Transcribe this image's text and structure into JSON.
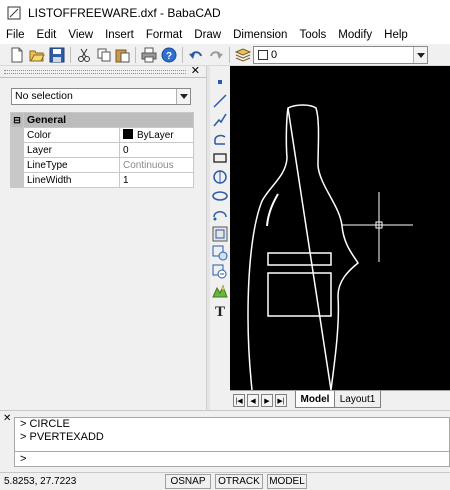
{
  "window": {
    "title": "LISTOFFREEWARE.dxf - BabaCAD"
  },
  "menu": [
    "File",
    "Edit",
    "View",
    "Insert",
    "Format",
    "Draw",
    "Dimension",
    "Tools",
    "Modify",
    "Help"
  ],
  "toolbar": {
    "icons": [
      "new-icon",
      "open-icon",
      "save-icon",
      "cut-icon",
      "copy-icon",
      "paste-icon",
      "print-icon",
      "help-icon",
      "undo-icon",
      "redo-icon",
      "layers-icon"
    ],
    "layer_value": "0"
  },
  "properties": {
    "selection": "No selection",
    "group": "General",
    "rows": [
      {
        "name": "Color",
        "value": "ByLayer"
      },
      {
        "name": "Layer",
        "value": "0"
      },
      {
        "name": "LineType",
        "value": "Continuous"
      },
      {
        "name": "LineWidth",
        "value": "1"
      }
    ]
  },
  "draw_tools": [
    "point-icon",
    "line-icon",
    "polyline-icon",
    "arc-icon",
    "rectangle-icon",
    "circle-icon",
    "ellipse-icon",
    "spline-icon",
    "block-icon",
    "hatch-icon",
    "insert-image-icon",
    "mountain-icon",
    "text-icon"
  ],
  "tabs": {
    "model": "Model",
    "layout": "Layout1"
  },
  "command": {
    "history": [
      "> CIRCLE",
      "> PVERTEXADD"
    ],
    "prompt": ">"
  },
  "status": {
    "coords": "5.8253, 27.7223",
    "osnap": "OSNAP",
    "otrack": "OTRACK",
    "model": "MODEL"
  }
}
